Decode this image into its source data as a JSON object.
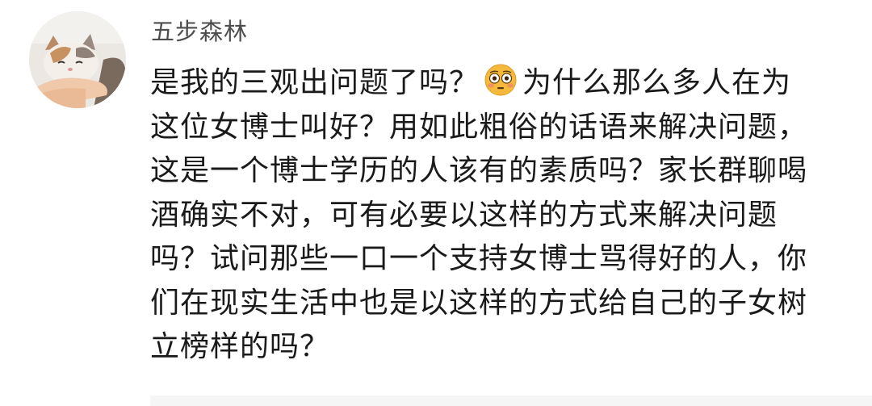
{
  "user": {
    "name": "五步森林",
    "avatar_icon": "cat-avatar-icon"
  },
  "comment": {
    "line1_a": "是我的三观出问题了吗？",
    "emoji_icon": "flushed-face-emoji-icon",
    "line1_b": "为什么那么多人在为",
    "line2": "这位女博士叫好？用如此粗俗的话语来解决问题，",
    "line3": "这是一个博士学历的人该有的素质吗？家长群聊喝",
    "line4": "酒确实不对，可有必要以这样的方式来解决问题",
    "line5": "吗？试问那些一口一个支持女博士骂得好的人，你",
    "line6": "们在现实生活中也是以这样的方式给自己的子女树",
    "line7": "立榜样的吗？"
  },
  "colors": {
    "username": "#4d4d4d",
    "text": "#1a1a1a",
    "reply_bg": "#f5f5f5",
    "emoji_face": "#f5b93b"
  }
}
